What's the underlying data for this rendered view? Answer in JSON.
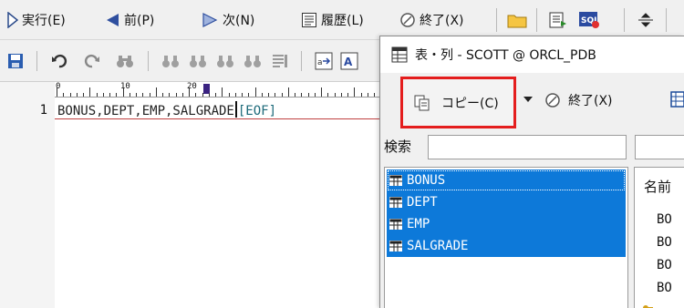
{
  "toolbar1": {
    "run_label": "実行(E)",
    "prev_label": "前(P)",
    "next_label": "次(N)",
    "history_label": "履歴(L)",
    "end_label": "終了(X)"
  },
  "editor": {
    "ruler_labels": [
      "0",
      "10",
      "20"
    ],
    "line_number": "1",
    "code": "BONUS,DEPT,EMP,SALGRADE",
    "eof_marker": "[EOF]"
  },
  "dialog": {
    "title": "表・列 - SCOTT @ ORCL_PDB",
    "copy_label": "コピー(C)",
    "end_label": "終了(X)",
    "search_label": "検索",
    "search_value": "",
    "tables": [
      {
        "name": "BONUS"
      },
      {
        "name": "DEPT"
      },
      {
        "name": "EMP"
      },
      {
        "name": "SALGRADE"
      }
    ],
    "detail_header": "名前",
    "detail_cells": [
      "BO",
      "BO",
      "BO",
      "BO"
    ]
  },
  "colors": {
    "highlight": "#e41d1d",
    "selection": "#0d79d9",
    "eof": "#1d6a7a"
  }
}
